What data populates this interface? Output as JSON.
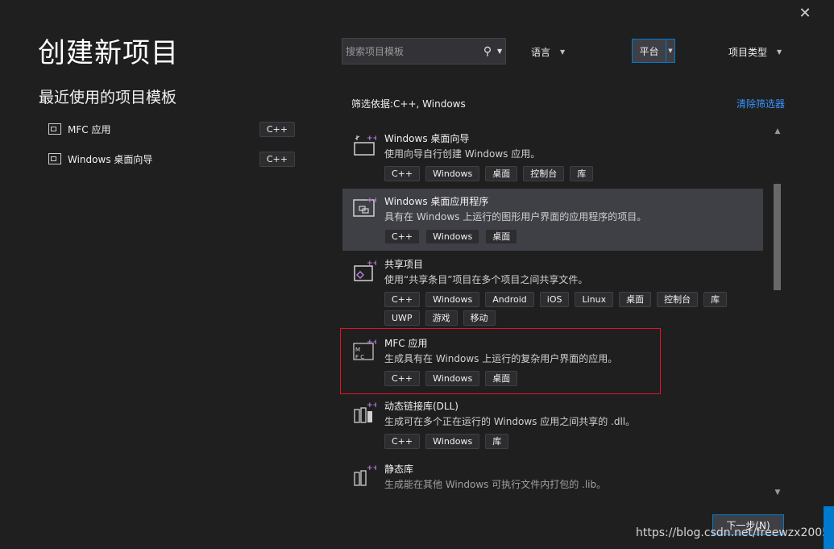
{
  "dialog": {
    "title": "创建新项目",
    "close_glyph": "✕",
    "recent_heading": "最近使用的项目模板",
    "recent_templates": [
      {
        "name": "MFC 应用",
        "lang": "C++",
        "icon": "mfc-app-icon"
      },
      {
        "name": "Windows 桌面向导",
        "lang": "C++",
        "icon": "windows-desktop-wizard-icon"
      }
    ]
  },
  "search": {
    "placeholder": "搜索项目模板",
    "icon": "search-icon"
  },
  "filters": {
    "language": "语言",
    "platform": "平台",
    "project_type": "项目类型",
    "filter_by": "筛选依据:C++, Windows",
    "clear": "清除筛选器"
  },
  "templates": [
    {
      "name": "Windows 桌面向导",
      "desc": "使用向导自行创建 Windows 应用。",
      "tags": [
        "C++",
        "Windows",
        "桌面",
        "控制台",
        "库"
      ]
    },
    {
      "name": "Windows 桌面应用程序",
      "desc": "具有在 Windows 上运行的图形用户界面的应用程序的项目。",
      "tags": [
        "C++",
        "Windows",
        "桌面"
      ]
    },
    {
      "name": "共享项目",
      "desc": "使用“共享条目”项目在多个项目之间共享文件。",
      "tags": [
        "C++",
        "Windows",
        "Android",
        "iOS",
        "Linux",
        "桌面",
        "控制台",
        "库",
        "UWP",
        "游戏",
        "移动"
      ]
    },
    {
      "name": "MFC 应用",
      "desc": "生成具有在 Windows 上运行的复杂用户界面的应用。",
      "tags": [
        "C++",
        "Windows",
        "桌面"
      ]
    },
    {
      "name": "动态链接库(DLL)",
      "desc": "生成可在多个正在运行的 Windows 应用之间共享的 .dll。",
      "tags": [
        "C++",
        "Windows",
        "库"
      ]
    },
    {
      "name": "静态库",
      "desc": "生成能在其他 Windows 可执行文件内打包的 .lib。",
      "tags": []
    }
  ],
  "colors": {
    "accent": "#007acc",
    "selection": "#3f3f46",
    "highlight_box": "#e81123",
    "link": "#3794ff"
  },
  "footer": {
    "next_label": "下一步(N)",
    "watermark": "https://blog.csdn.net/freewzx2005"
  }
}
